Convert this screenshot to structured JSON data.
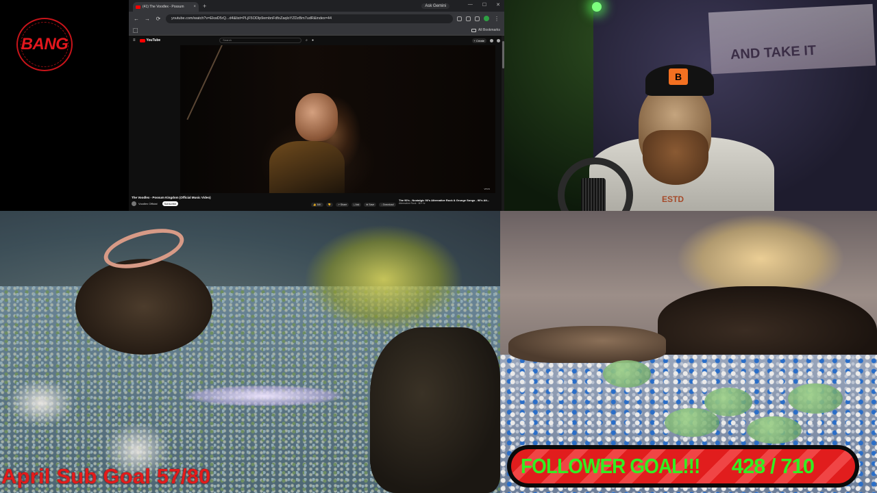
{
  "logo": {
    "text": "BANG"
  },
  "browser": {
    "tab_title": "(41) The Voodlex - Possum",
    "new_tab_symbol": "+",
    "gemini_button": "Ask Gemini",
    "window_controls": [
      "—",
      "☐",
      "✕"
    ],
    "url": "youtube.com/watch?v=EkwD5rQ...d4&list=PLjF5ODlp9embnFdfoZaqloYZDzBm7udR&index=44",
    "bookmarks_label": "All Bookmarks",
    "youtube_logo": "YouTube",
    "search_placeholder": "Search",
    "create_button": "+ Create",
    "video_title": "The Voodlex - Possum Kingdom (Official Music Video)",
    "channel_name": "Voodlex Official",
    "subscribe_label": "Subscribe",
    "actions": [
      "👍 34K",
      "👎",
      "↗ Share",
      "⤓ Ask",
      "⊕ Save",
      "↓ Download"
    ],
    "up_next_title": "The 90's - Nostalgic 90's Alternative Rock & Grunge Songs - 90's Alt...",
    "up_next_sub": "Alternative Rock · 80+ hr",
    "player_watermark": "vevo"
  },
  "webcam": {
    "cap_logo": "B",
    "flag_text": "AND TAKE IT",
    "shirt_text": "ESTD"
  },
  "overlays": {
    "sub_goal": "April Sub Goal 57/80",
    "follower_label": "FOLLOWER GOAL!!!",
    "follower_count": "428 / 710"
  },
  "colors": {
    "goal_red": "#e31b1b",
    "follower_green": "#33ee22",
    "bar_red": "#e11d1d"
  }
}
